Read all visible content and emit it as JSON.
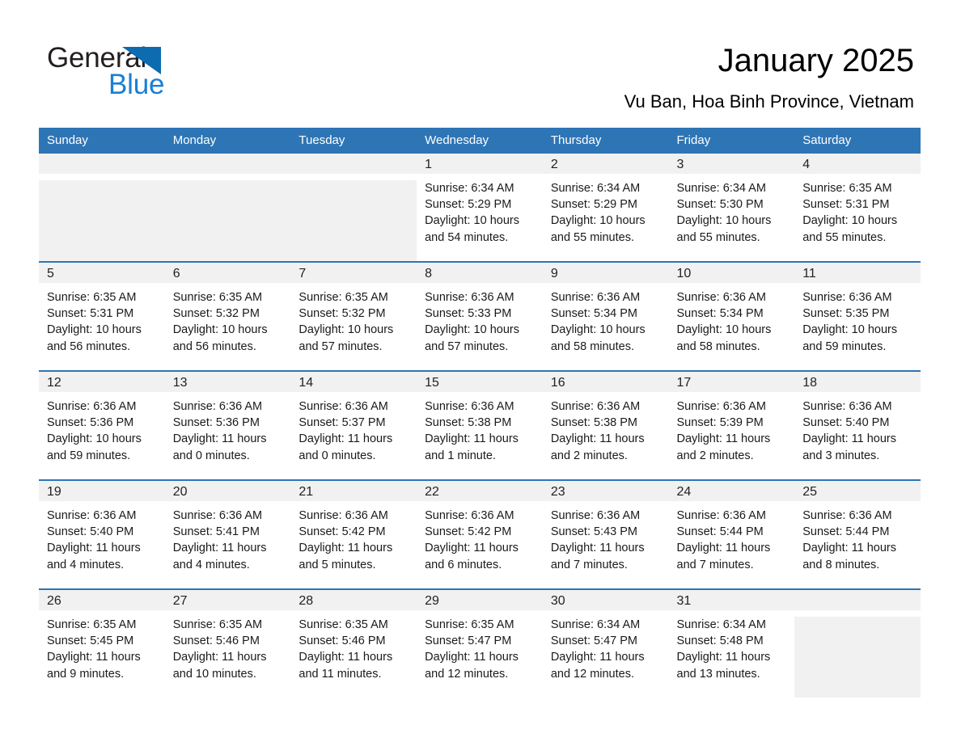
{
  "brand": {
    "name_part1": "General",
    "name_part2": "Blue",
    "triangle_icon": "triangle-logo-icon",
    "accent_color": "#0d6bb0",
    "blue_text_color": "#1a7fd4"
  },
  "header": {
    "title": "January 2025",
    "subtitle": "Vu Ban, Hoa Binh Province, Vietnam"
  },
  "theme": {
    "header_blue": "#2e75b6",
    "daynum_band": "#f1f1f1",
    "cell_background": "#ffffff"
  },
  "weekday_headers": [
    "Sunday",
    "Monday",
    "Tuesday",
    "Wednesday",
    "Thursday",
    "Friday",
    "Saturday"
  ],
  "weeks": [
    [
      {
        "day": "",
        "lines": []
      },
      {
        "day": "",
        "lines": []
      },
      {
        "day": "",
        "lines": []
      },
      {
        "day": "1",
        "lines": [
          "Sunrise: 6:34 AM",
          "Sunset: 5:29 PM",
          "Daylight: 10 hours",
          "and 54 minutes."
        ]
      },
      {
        "day": "2",
        "lines": [
          "Sunrise: 6:34 AM",
          "Sunset: 5:29 PM",
          "Daylight: 10 hours",
          "and 55 minutes."
        ]
      },
      {
        "day": "3",
        "lines": [
          "Sunrise: 6:34 AM",
          "Sunset: 5:30 PM",
          "Daylight: 10 hours",
          "and 55 minutes."
        ]
      },
      {
        "day": "4",
        "lines": [
          "Sunrise: 6:35 AM",
          "Sunset: 5:31 PM",
          "Daylight: 10 hours",
          "and 55 minutes."
        ]
      }
    ],
    [
      {
        "day": "5",
        "lines": [
          "Sunrise: 6:35 AM",
          "Sunset: 5:31 PM",
          "Daylight: 10 hours",
          "and 56 minutes."
        ]
      },
      {
        "day": "6",
        "lines": [
          "Sunrise: 6:35 AM",
          "Sunset: 5:32 PM",
          "Daylight: 10 hours",
          "and 56 minutes."
        ]
      },
      {
        "day": "7",
        "lines": [
          "Sunrise: 6:35 AM",
          "Sunset: 5:32 PM",
          "Daylight: 10 hours",
          "and 57 minutes."
        ]
      },
      {
        "day": "8",
        "lines": [
          "Sunrise: 6:36 AM",
          "Sunset: 5:33 PM",
          "Daylight: 10 hours",
          "and 57 minutes."
        ]
      },
      {
        "day": "9",
        "lines": [
          "Sunrise: 6:36 AM",
          "Sunset: 5:34 PM",
          "Daylight: 10 hours",
          "and 58 minutes."
        ]
      },
      {
        "day": "10",
        "lines": [
          "Sunrise: 6:36 AM",
          "Sunset: 5:34 PM",
          "Daylight: 10 hours",
          "and 58 minutes."
        ]
      },
      {
        "day": "11",
        "lines": [
          "Sunrise: 6:36 AM",
          "Sunset: 5:35 PM",
          "Daylight: 10 hours",
          "and 59 minutes."
        ]
      }
    ],
    [
      {
        "day": "12",
        "lines": [
          "Sunrise: 6:36 AM",
          "Sunset: 5:36 PM",
          "Daylight: 10 hours",
          "and 59 minutes."
        ]
      },
      {
        "day": "13",
        "lines": [
          "Sunrise: 6:36 AM",
          "Sunset: 5:36 PM",
          "Daylight: 11 hours",
          "and 0 minutes."
        ]
      },
      {
        "day": "14",
        "lines": [
          "Sunrise: 6:36 AM",
          "Sunset: 5:37 PM",
          "Daylight: 11 hours",
          "and 0 minutes."
        ]
      },
      {
        "day": "15",
        "lines": [
          "Sunrise: 6:36 AM",
          "Sunset: 5:38 PM",
          "Daylight: 11 hours",
          "and 1 minute."
        ]
      },
      {
        "day": "16",
        "lines": [
          "Sunrise: 6:36 AM",
          "Sunset: 5:38 PM",
          "Daylight: 11 hours",
          "and 2 minutes."
        ]
      },
      {
        "day": "17",
        "lines": [
          "Sunrise: 6:36 AM",
          "Sunset: 5:39 PM",
          "Daylight: 11 hours",
          "and 2 minutes."
        ]
      },
      {
        "day": "18",
        "lines": [
          "Sunrise: 6:36 AM",
          "Sunset: 5:40 PM",
          "Daylight: 11 hours",
          "and 3 minutes."
        ]
      }
    ],
    [
      {
        "day": "19",
        "lines": [
          "Sunrise: 6:36 AM",
          "Sunset: 5:40 PM",
          "Daylight: 11 hours",
          "and 4 minutes."
        ]
      },
      {
        "day": "20",
        "lines": [
          "Sunrise: 6:36 AM",
          "Sunset: 5:41 PM",
          "Daylight: 11 hours",
          "and 4 minutes."
        ]
      },
      {
        "day": "21",
        "lines": [
          "Sunrise: 6:36 AM",
          "Sunset: 5:42 PM",
          "Daylight: 11 hours",
          "and 5 minutes."
        ]
      },
      {
        "day": "22",
        "lines": [
          "Sunrise: 6:36 AM",
          "Sunset: 5:42 PM",
          "Daylight: 11 hours",
          "and 6 minutes."
        ]
      },
      {
        "day": "23",
        "lines": [
          "Sunrise: 6:36 AM",
          "Sunset: 5:43 PM",
          "Daylight: 11 hours",
          "and 7 minutes."
        ]
      },
      {
        "day": "24",
        "lines": [
          "Sunrise: 6:36 AM",
          "Sunset: 5:44 PM",
          "Daylight: 11 hours",
          "and 7 minutes."
        ]
      },
      {
        "day": "25",
        "lines": [
          "Sunrise: 6:36 AM",
          "Sunset: 5:44 PM",
          "Daylight: 11 hours",
          "and 8 minutes."
        ]
      }
    ],
    [
      {
        "day": "26",
        "lines": [
          "Sunrise: 6:35 AM",
          "Sunset: 5:45 PM",
          "Daylight: 11 hours",
          "and 9 minutes."
        ]
      },
      {
        "day": "27",
        "lines": [
          "Sunrise: 6:35 AM",
          "Sunset: 5:46 PM",
          "Daylight: 11 hours",
          "and 10 minutes."
        ]
      },
      {
        "day": "28",
        "lines": [
          "Sunrise: 6:35 AM",
          "Sunset: 5:46 PM",
          "Daylight: 11 hours",
          "and 11 minutes."
        ]
      },
      {
        "day": "29",
        "lines": [
          "Sunrise: 6:35 AM",
          "Sunset: 5:47 PM",
          "Daylight: 11 hours",
          "and 12 minutes."
        ]
      },
      {
        "day": "30",
        "lines": [
          "Sunrise: 6:34 AM",
          "Sunset: 5:47 PM",
          "Daylight: 11 hours",
          "and 12 minutes."
        ]
      },
      {
        "day": "31",
        "lines": [
          "Sunrise: 6:34 AM",
          "Sunset: 5:48 PM",
          "Daylight: 11 hours",
          "and 13 minutes."
        ]
      },
      {
        "day": "",
        "lines": []
      }
    ]
  ]
}
